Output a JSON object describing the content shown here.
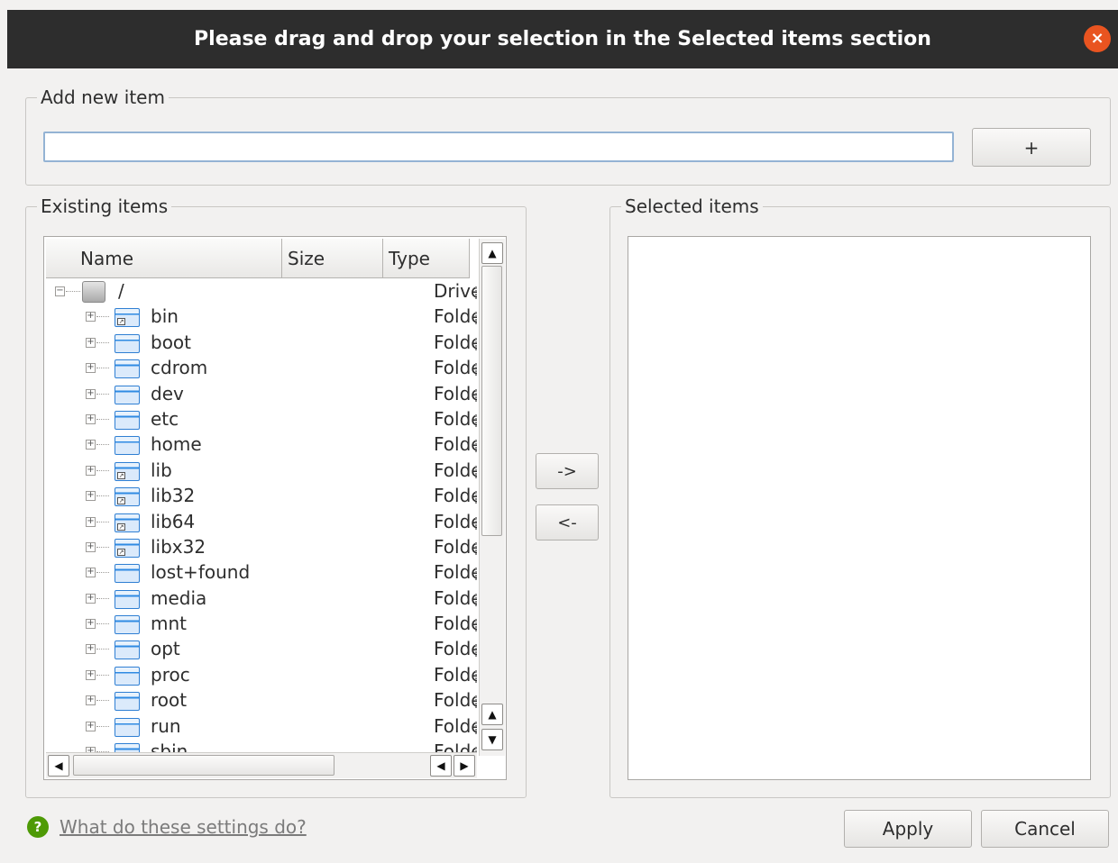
{
  "window": {
    "title": "Please drag and drop your selection in the Selected items section",
    "close_symbol": "×"
  },
  "add_new": {
    "legend": "Add new item",
    "input_value": "",
    "add_button": "+"
  },
  "existing": {
    "legend": "Existing items",
    "columns": [
      "Name",
      "Size",
      "Type"
    ],
    "root": {
      "name": "/",
      "type": "Drive",
      "expander": "−",
      "icon": "drive-icon"
    },
    "rows": [
      {
        "name": "bin",
        "type": "Folder",
        "symlink": true
      },
      {
        "name": "boot",
        "type": "Folder",
        "symlink": false
      },
      {
        "name": "cdrom",
        "type": "Folder",
        "symlink": false
      },
      {
        "name": "dev",
        "type": "Folder",
        "symlink": false
      },
      {
        "name": "etc",
        "type": "Folder",
        "symlink": false
      },
      {
        "name": "home",
        "type": "Folder",
        "symlink": false
      },
      {
        "name": "lib",
        "type": "Folder",
        "symlink": true
      },
      {
        "name": "lib32",
        "type": "Folder",
        "symlink": true
      },
      {
        "name": "lib64",
        "type": "Folder",
        "symlink": true
      },
      {
        "name": "libx32",
        "type": "Folder",
        "symlink": true
      },
      {
        "name": "lost+found",
        "type": "Folder",
        "symlink": false
      },
      {
        "name": "media",
        "type": "Folder",
        "symlink": false
      },
      {
        "name": "mnt",
        "type": "Folder",
        "symlink": false
      },
      {
        "name": "opt",
        "type": "Folder",
        "symlink": false
      },
      {
        "name": "proc",
        "type": "Folder",
        "symlink": false
      },
      {
        "name": "root",
        "type": "Folder",
        "symlink": false
      },
      {
        "name": "run",
        "type": "Folder",
        "symlink": false
      },
      {
        "name": "sbin",
        "type": "Folder",
        "symlink": true
      }
    ],
    "scroll_up": "▲",
    "scroll_down": "▼",
    "scroll_left": "◀",
    "scroll_right": "▶"
  },
  "transfer": {
    "add": "->",
    "remove": "<-"
  },
  "selected": {
    "legend": "Selected items",
    "items": []
  },
  "footer": {
    "help_icon": "?",
    "help_link": "What do these settings do?",
    "apply": "Apply",
    "cancel": "Cancel"
  },
  "colors": {
    "titlebar": "#2d2d2d",
    "close": "#e95420",
    "folder": "#2f8be3",
    "help": "#4e9a06"
  }
}
